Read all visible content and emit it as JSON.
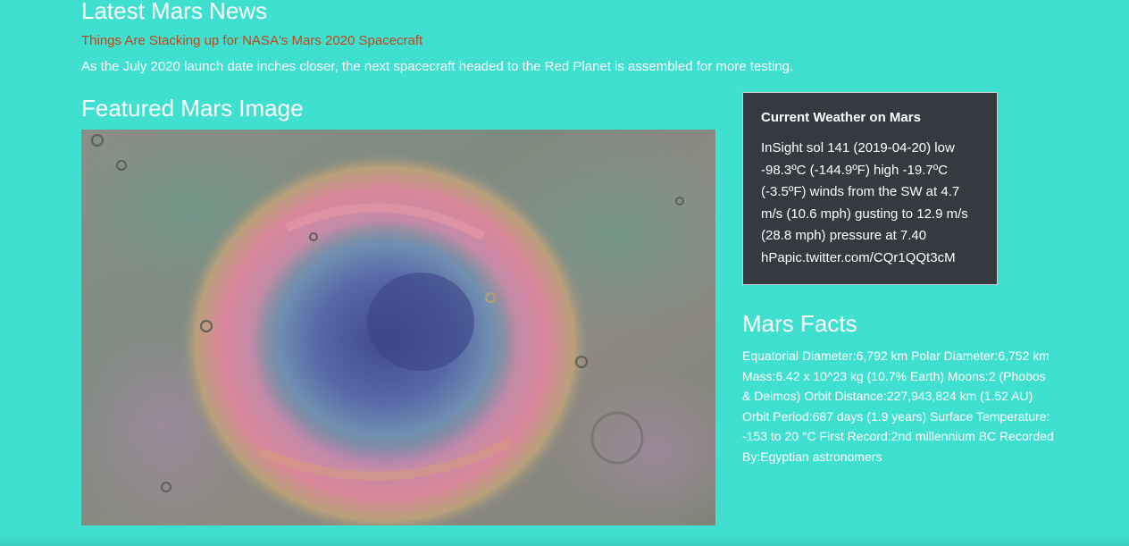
{
  "news": {
    "section_title": "Latest Mars News",
    "headline": "Things Are Stacking up for NASA's Mars 2020 Spacecraft",
    "teaser": "As the July 2020 launch date inches closer, the next spacecraft headed to the Red Planet is assembled for more testing."
  },
  "featured": {
    "section_title": "Featured Mars Image",
    "image_alt": "Featured Mars Image"
  },
  "weather": {
    "card_title": "Current Weather on Mars",
    "text": "InSight sol 141 (2019-04-20) low -98.3ºC (-144.9ºF) high -19.7ºC (-3.5ºF) winds from the SW at 4.7 m/s (10.6 mph) gusting to 12.9 m/s (28.8 mph) pressure at 7.40 hPapic.twitter.com/CQr1QQt3cM"
  },
  "facts": {
    "section_title": "Mars Facts",
    "text": "Equatorial Diameter:6,792 km Polar Diameter:6,752 km Mass:6.42 x 10^23 kg (10.7% Earth) Moons:2 (Phobos & Deimos) Orbit Distance:227,943,824 km (1.52 AU) Orbit Period:687 days (1.9 years) Surface Temperature: -153 to 20 °C First Record:2nd millennium BC Recorded By:Egyptian astronomers"
  },
  "colors": {
    "page_background": "#40e0d0",
    "headline_link": "#c0461a",
    "weather_card_background": "#343a40"
  }
}
